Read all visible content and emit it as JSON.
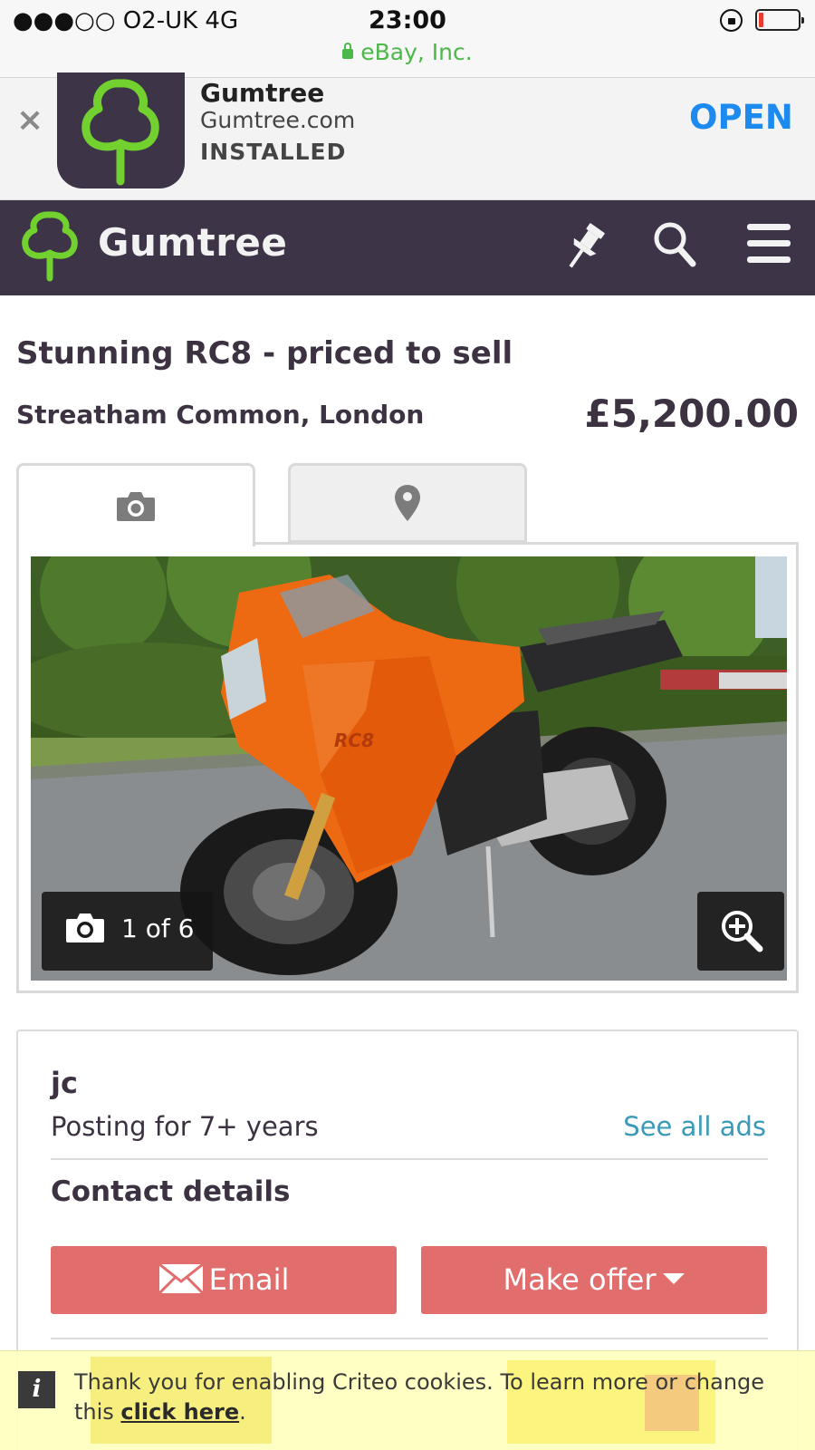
{
  "status_bar": {
    "carrier": "●●●○○ O2-UK   4G",
    "time": "23:00",
    "url": "eBay, Inc."
  },
  "app_banner": {
    "close_glyph": "×",
    "app_name": "Gumtree",
    "site": "Gumtree.com",
    "status": "INSTALLED",
    "open_label": "OPEN"
  },
  "header": {
    "brand": "Gumtree",
    "brand_color": "#3d3447",
    "logo_color": "#72d12f",
    "icons": [
      "gumtree-tree-logo-icon",
      "pin-icon",
      "search-icon",
      "hamburger-menu-icon"
    ]
  },
  "listing": {
    "title": "Stunning RC8 - priced to sell",
    "location": "Streatham Common, London",
    "price": "£5,200.00",
    "tabs": [
      {
        "icon": "camera-icon",
        "active": true
      },
      {
        "icon": "map-pin-icon",
        "active": false
      }
    ],
    "gallery": {
      "counter": "1 of 6",
      "zoom_icon": "zoom-in-icon",
      "photo_text": "RC8"
    }
  },
  "seller": {
    "name": "jc",
    "since": "Posting for 7+ years",
    "see_all_ads": "See all ads",
    "contact_heading": "Contact details",
    "email_label": "Email",
    "offer_label": "Make offer",
    "button_color": "#e26d6d",
    "link_color": "#3a9ab8"
  },
  "cookie_banner": {
    "info_glyph": "i",
    "text_before": "Thank you for enabling Criteo cookies. To learn more or change this ",
    "link_text": "click here",
    "text_after": "."
  }
}
